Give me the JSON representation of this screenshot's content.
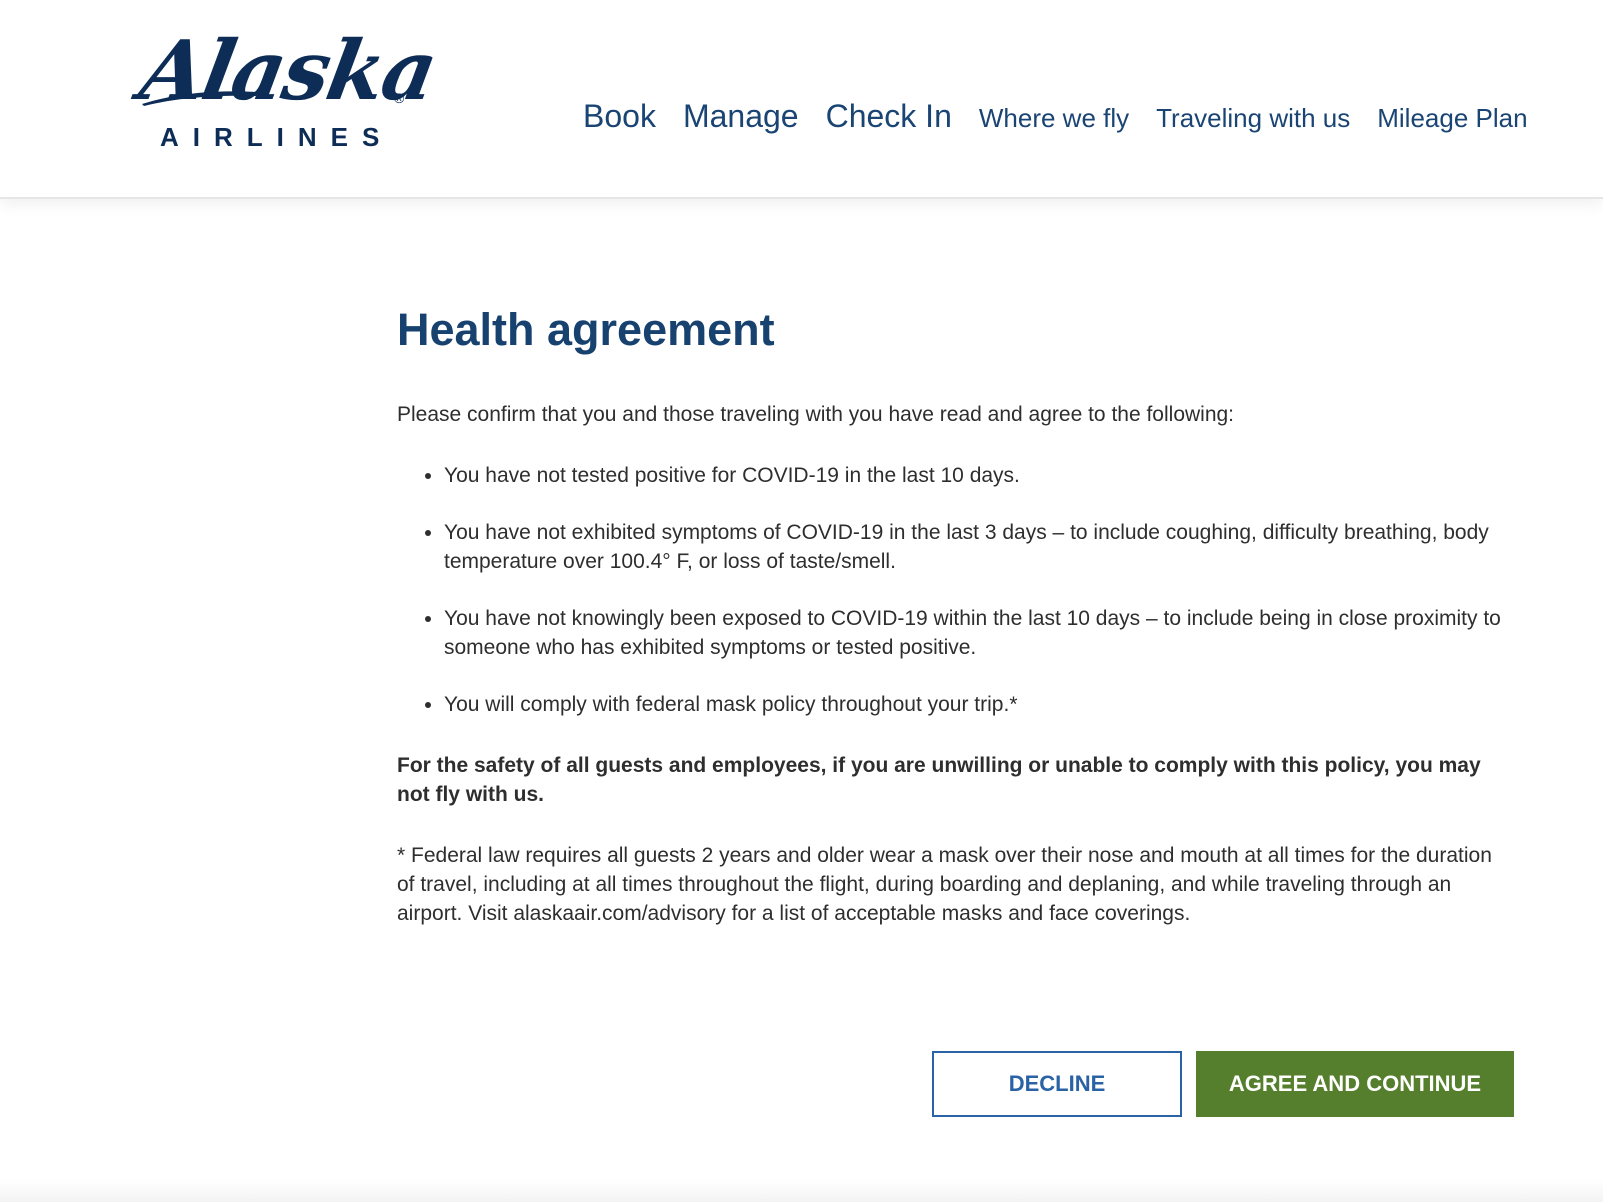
{
  "brand": {
    "wordmark": "Alaska",
    "registered": "®",
    "subtitle": "AIRLINES",
    "color": "#0d2d57"
  },
  "nav": {
    "items": [
      {
        "label": "Book"
      },
      {
        "label": "Manage"
      },
      {
        "label": "Check In"
      },
      {
        "label": "Where we fly"
      },
      {
        "label": "Traveling with us"
      },
      {
        "label": "Mileage Plan"
      }
    ]
  },
  "page": {
    "title": "Health agreement",
    "intro": "Please confirm that you and those traveling with you have read and agree to the following:",
    "bullets": [
      "You have not tested positive for COVID-19 in the last 10 days.",
      "You have not exhibited symptoms of COVID-19 in the last 3 days – to include coughing, difficulty breathing, body temperature over 100.4° F, or loss of taste/smell.",
      "You have not knowingly been exposed to COVID-19 within the last 10 days – to include being in close proximity to someone who has exhibited symptoms or tested positive.",
      "You will comply with federal mask policy throughout your trip.*"
    ],
    "warning": "For the safety of all guests and employees, if you are unwilling or unable to comply with this policy, you may not fly with us.",
    "footnote": "* Federal law requires all guests 2 years and older wear a mask over their nose and mouth at all times for the duration of travel, including at all times throughout the flight, during boarding and deplaning, and while traveling through an airport. Visit alaskaair.com/advisory for a list of acceptable masks and face coverings."
  },
  "actions": {
    "decline_label": "DECLINE",
    "agree_label": "AGREE AND CONTINUE"
  },
  "colors": {
    "nav_text": "#1a4473",
    "title": "#17416f",
    "decline_border": "#2a62a6",
    "agree_bg": "#557f2c"
  }
}
